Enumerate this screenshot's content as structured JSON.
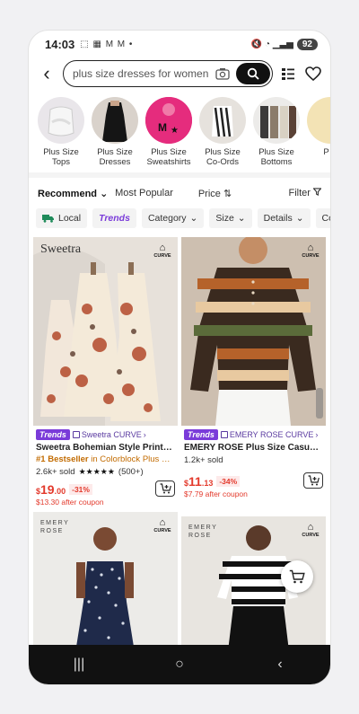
{
  "status": {
    "time": "14:03",
    "left_icons": "⬚ ▦ M M •",
    "right_icons": "🔇 ◔ ▁▃▅",
    "battery": "92"
  },
  "search": {
    "value": "plus size dresses for women",
    "placeholder": "Search"
  },
  "categories": [
    {
      "label": "Plus Size Tops"
    },
    {
      "label": "Plus Size Dresses"
    },
    {
      "label": "Plus Size Sweatshirts"
    },
    {
      "label": "Plus Size Co-Ords"
    },
    {
      "label": "Plus Size Bottoms"
    },
    {
      "label": "P K"
    }
  ],
  "sort": {
    "recommend": "Recommend",
    "popular": "Most Popular",
    "price": "Price",
    "filter": "Filter"
  },
  "filters": [
    "Local",
    "Trends",
    "Category",
    "Size",
    "Details",
    "Color"
  ],
  "products": [
    {
      "brand_text": "Sweetra",
      "curve": "CURVE",
      "trend_tag": "Trends",
      "store": "Sweetra CURVE",
      "title": "Sweetra Bohemian Style Printed S...",
      "bestseller_rank": "#1 Bestseller",
      "bestseller_cat": "in Colorblock Plus Si...",
      "sold": "2.6k+ sold",
      "stars": "★★★★★",
      "reviews": "(500+)",
      "price_symbol": "$",
      "price_int": "19",
      "price_dec": ".00",
      "discount": "-31%",
      "after_coupon": "$13.30 after coupon"
    },
    {
      "curve": "CURVE",
      "trend_tag": "Trends",
      "store": "EMERY ROSE CURVE",
      "title": "EMERY ROSE Plus Size Casual Co...",
      "sold": "1.2k+ sold",
      "price_symbol": "$",
      "price_int": "11",
      "price_dec": ".13",
      "discount": "-34%",
      "after_coupon": "$7.79 after coupon"
    },
    {
      "brand_text": "EMERY\nROSE",
      "curve": "CURVE"
    },
    {
      "brand_text": "EMERY\nROSE",
      "curve": "CURVE"
    }
  ],
  "nav": {
    "recent": "|||",
    "home": "○",
    "back": "‹"
  },
  "colors": {
    "accent_purple": "#7a3bd9",
    "price_red": "#e33a2c",
    "bestseller_orange": "#c26b00"
  }
}
